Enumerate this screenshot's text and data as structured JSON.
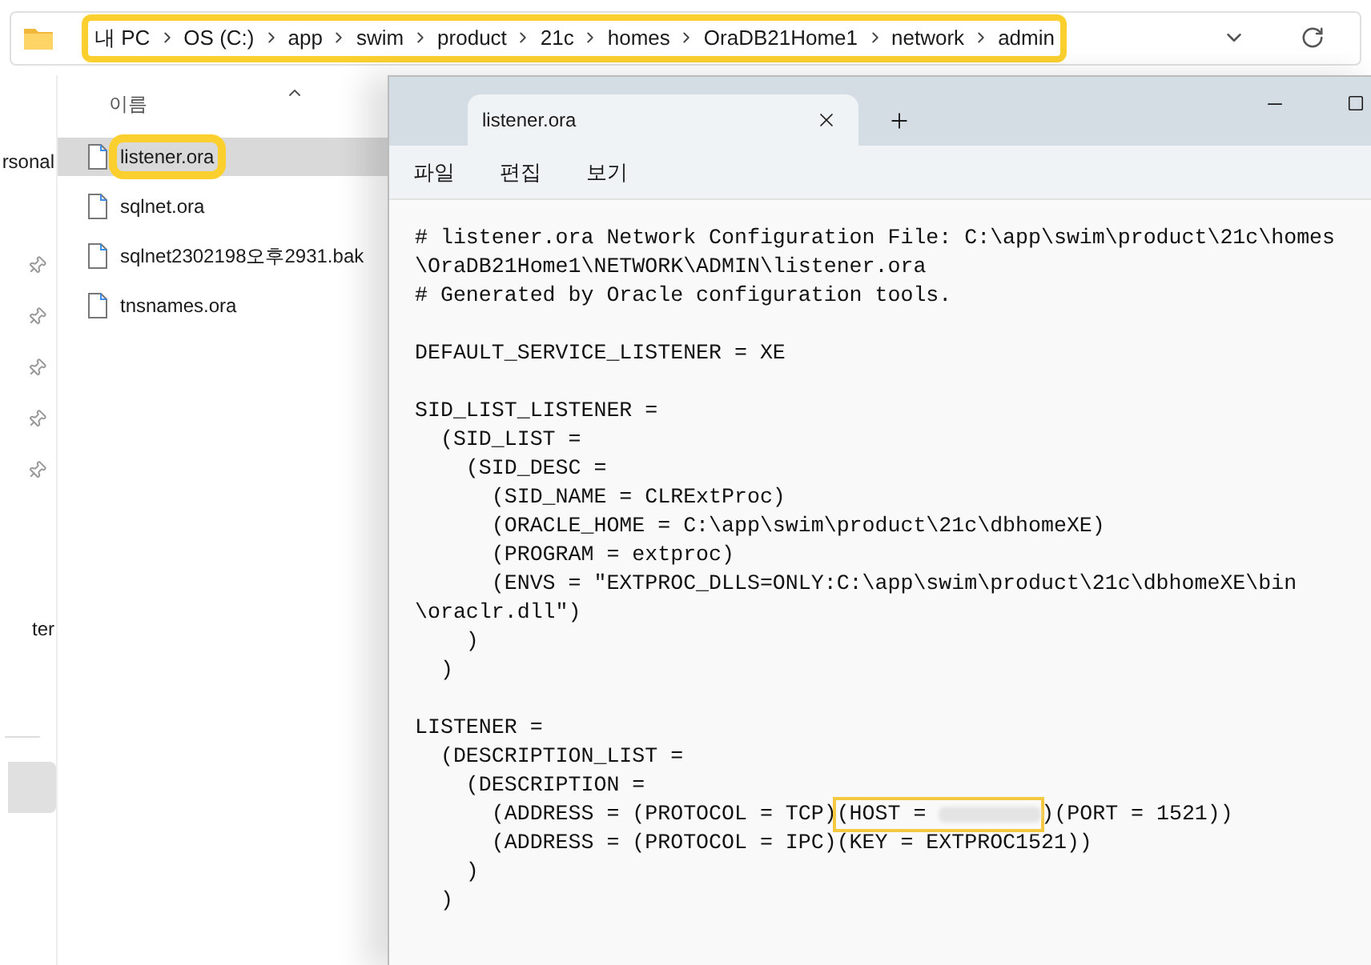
{
  "address_bar": {
    "crumbs": [
      "내 PC",
      "OS (C:)",
      "app",
      "swim",
      "product",
      "21c",
      "homes",
      "OraDB21Home1",
      "network",
      "admin"
    ],
    "highlighted": true
  },
  "nav_pane": {
    "items": [
      {
        "label": "rsonal",
        "kind": "text"
      },
      {
        "kind": "pin"
      },
      {
        "kind": "pin"
      },
      {
        "kind": "pin"
      },
      {
        "kind": "pin"
      },
      {
        "kind": "pin"
      },
      {
        "label": "ter",
        "kind": "text"
      },
      {
        "kind": "divider"
      },
      {
        "kind": "selected-block"
      }
    ]
  },
  "file_list": {
    "column": "이름",
    "files": [
      {
        "name": "listener.ora",
        "selected": true,
        "highlighted": true
      },
      {
        "name": "sqlnet.ora",
        "selected": false,
        "highlighted": false
      },
      {
        "name": "sqlnet2302198오후2931.bak",
        "selected": false,
        "highlighted": false
      },
      {
        "name": "tnsnames.ora",
        "selected": false,
        "highlighted": false
      }
    ]
  },
  "notepad": {
    "tabs": [
      {
        "title": "listener.ora",
        "selected": true
      }
    ],
    "menu": [
      "파일",
      "편집",
      "보기"
    ],
    "blocks": [
      {
        "lines": [
          {
            "text": "# listener.ora Network Configuration File: C:\\app\\swim\\product\\21c\\homes"
          },
          {
            "text": "\\OraDB21Home1\\NETWORK\\ADMIN\\listener.ora"
          },
          {
            "text": "# Generated by Oracle configuration tools."
          }
        ]
      },
      {
        "lines": [
          {
            "text": "DEFAULT_SERVICE_LISTENER = XE"
          }
        ]
      },
      {
        "lines": [
          {
            "text": "SID_LIST_LISTENER ="
          },
          {
            "text": "  (SID_LIST ="
          },
          {
            "text": "    (SID_DESC ="
          },
          {
            "text": "      (SID_NAME = CLRExtProc)"
          },
          {
            "text": "      (ORACLE_HOME = C:\\app\\swim\\product\\21c\\dbhomeXE)"
          },
          {
            "text": "      (PROGRAM = extproc)"
          },
          {
            "text": "      (ENVS = \"EXTPROC_DLLS=ONLY:C:\\app\\swim\\product\\21c\\dbhomeXE\\bin"
          },
          {
            "text": "\\oraclr.dll\")"
          },
          {
            "text": "    )"
          },
          {
            "text": "  )"
          }
        ]
      },
      {
        "lines": [
          {
            "text": "LISTENER ="
          },
          {
            "text": "  (DESCRIPTION_LIST ="
          },
          {
            "text": "    (DESCRIPTION ="
          },
          {
            "text": "      (ADDRESS = (PROTOCOL = TCP)",
            "highlight": "(HOST = ",
            "redacted": true,
            "after": ")(PORT = 1521))"
          },
          {
            "text": "      (ADDRESS = (PROTOCOL = IPC)(KEY = EXTPROC1521))"
          },
          {
            "text": "    )"
          },
          {
            "text": "  )"
          }
        ]
      }
    ]
  }
}
